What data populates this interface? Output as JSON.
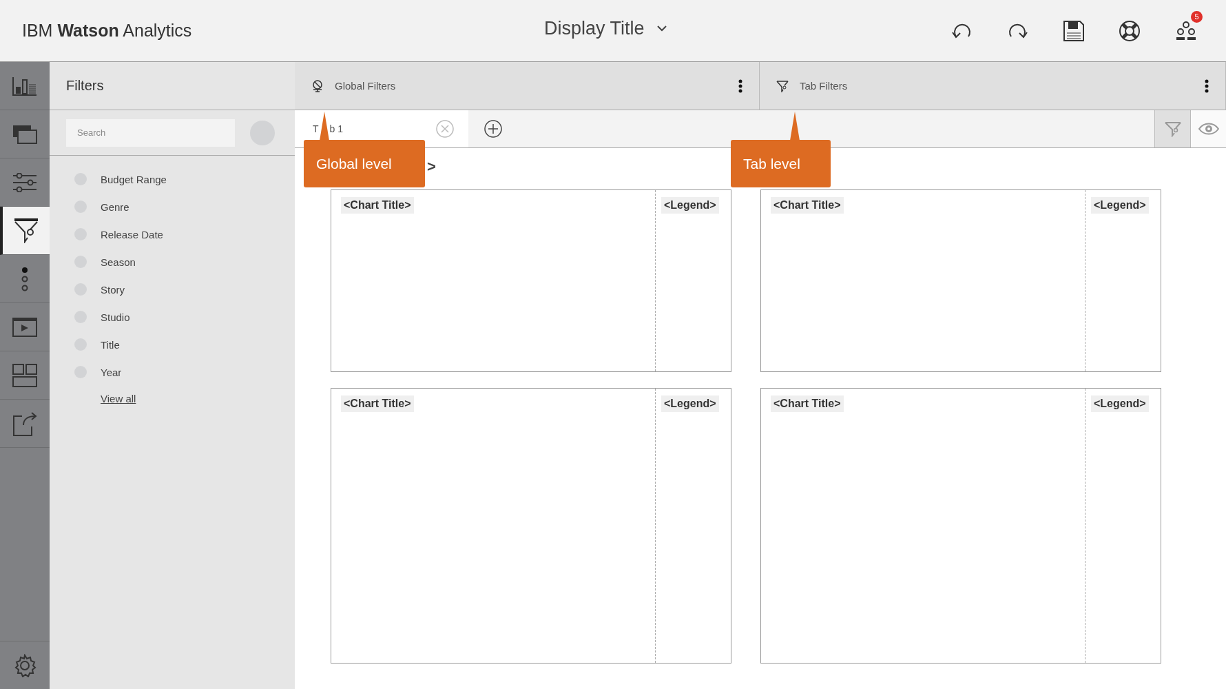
{
  "brand": "IBM **Watson** Analytics",
  "display_title": "Display Title",
  "notification_count": "5",
  "rail": [
    {
      "kind": "visualizations",
      "selected": false
    },
    {
      "kind": "layers",
      "selected": false
    },
    {
      "kind": "properties",
      "selected": false
    },
    {
      "kind": "filters",
      "selected": true
    },
    {
      "kind": "steps",
      "selected": false
    },
    {
      "kind": "present",
      "selected": false
    },
    {
      "kind": "layout",
      "selected": false
    },
    {
      "kind": "share",
      "selected": false
    }
  ],
  "filters_panel": {
    "title": "Filters",
    "search_placeholder": "Search",
    "fields": [
      "Budget Range",
      "Genre",
      "Release Date",
      "Season",
      "Story",
      "Studio",
      "Title",
      "Year"
    ],
    "view_all": "View all"
  },
  "global_filters": {
    "label": "Global Filters"
  },
  "tab_filters": {
    "label": "Tab Filters"
  },
  "tabs": [
    {
      "label_parts": [
        "T",
        "b 1"
      ],
      "selected": true
    }
  ],
  "page_title_fragment": ">",
  "charts": [
    {
      "title": "<Chart Title>",
      "legend": "<Legend>"
    },
    {
      "title": "<Chart Title>",
      "legend": "<Legend>"
    },
    {
      "title": "<Chart Title>",
      "legend": "<Legend>"
    },
    {
      "title": "<Chart Title>",
      "legend": "<Legend>"
    }
  ],
  "callouts": [
    {
      "text": "Global level"
    },
    {
      "text": "Tab level"
    }
  ]
}
